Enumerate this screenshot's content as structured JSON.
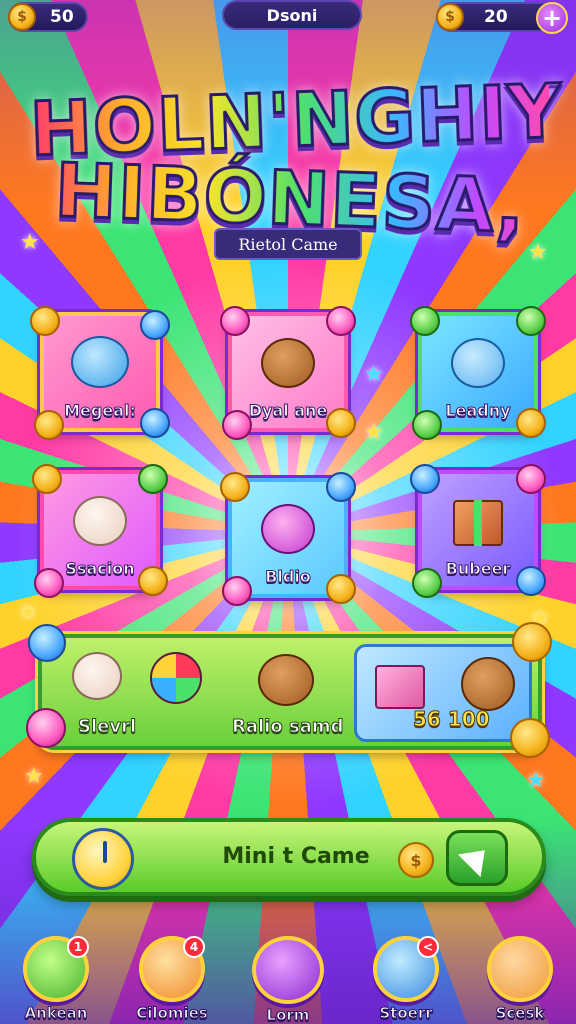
{
  "top_bar": {
    "coins_left": "50",
    "title": "Dsoni",
    "coins_right": "20",
    "plus_label": "+"
  },
  "logo": {
    "line1": "HOLN'NGHIY",
    "line2": "HIBÓNESA,"
  },
  "subtitle": "Rietol Came",
  "tiles": [
    {
      "label": "Megeal:"
    },
    {
      "label": "Dyal ane"
    },
    {
      "label": "Leadny"
    },
    {
      "label": "Ssacion"
    },
    {
      "label": "Bldio"
    },
    {
      "label": "Bubeer"
    }
  ],
  "panel": {
    "left_label": "Slevrl",
    "center_label": "Ralio samd",
    "price": "56 100"
  },
  "mini_game": {
    "label": "Mini t Came",
    "coin_symbol": "$"
  },
  "nav": [
    {
      "label": "Ankean",
      "badge": "1"
    },
    {
      "label": "Cilomies",
      "badge": "4"
    },
    {
      "label": "Lorm",
      "badge": ""
    },
    {
      "label": "Stoerr",
      "badge": "<"
    },
    {
      "label": "Scesk",
      "badge": ""
    }
  ],
  "icons": {
    "coin": "coin-icon",
    "plus": "plus-icon",
    "clock": "clock-icon",
    "go": "arrow-icon"
  },
  "colors": {
    "accent_gold": "#ffd23a",
    "panel_green": "#6ad03a",
    "nav_purple": "#7a2fd0"
  }
}
